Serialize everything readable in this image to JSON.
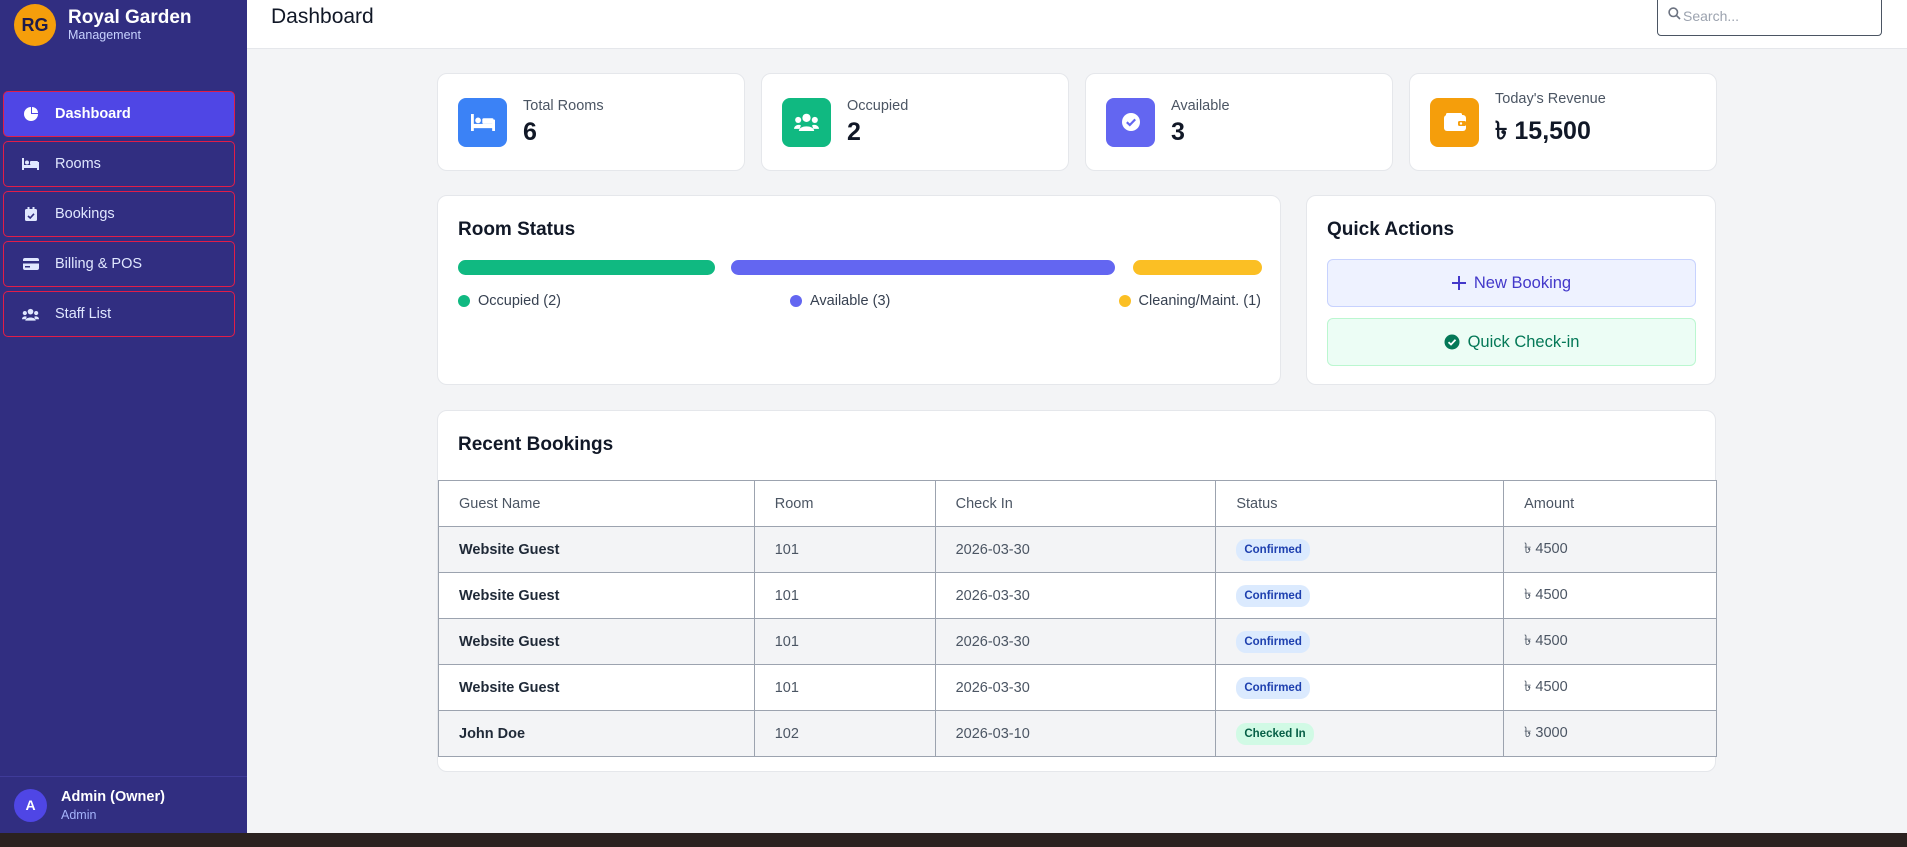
{
  "brand": {
    "logo": "RG",
    "title": "Royal Garden",
    "subtitle": "Management"
  },
  "sidebar": {
    "items": [
      {
        "label": "Dashboard",
        "icon": "pie-chart-icon",
        "active": true
      },
      {
        "label": "Rooms",
        "icon": "bed-icon"
      },
      {
        "label": "Bookings",
        "icon": "calendar-check-icon"
      },
      {
        "label": "Billing & POS",
        "icon": "credit-card-icon"
      },
      {
        "label": "Staff List",
        "icon": "users-icon"
      }
    ]
  },
  "user": {
    "initial": "A",
    "name": "Admin (Owner)",
    "role": "Admin"
  },
  "header": {
    "title": "Dashboard",
    "search_placeholder": "Search..."
  },
  "stats": [
    {
      "label": "Total Rooms",
      "value": "6",
      "color": "#3b82f6",
      "icon": "bed-icon"
    },
    {
      "label": "Occupied",
      "value": "2",
      "color": "#10b981",
      "icon": "users-icon"
    },
    {
      "label": "Available",
      "value": "3",
      "color": "#6366f1",
      "icon": "check-circle-icon"
    },
    {
      "label": "Today's Revenue",
      "value": "৳ 15,500",
      "color": "#f59e0b",
      "icon": "wallet-icon"
    }
  ],
  "room_status": {
    "title": "Room Status",
    "segments": [
      {
        "label": "Occupied (2)",
        "count": 2,
        "color": "#10b981"
      },
      {
        "label": "Available (3)",
        "count": 3,
        "color": "#6366f1"
      },
      {
        "label": "Cleaning/Maint. (1)",
        "count": 1,
        "color": "#fbbf24"
      }
    ]
  },
  "quick_actions": {
    "title": "Quick Actions",
    "new_booking": "New Booking",
    "quick_checkin": "Quick Check-in"
  },
  "recent_bookings": {
    "title": "Recent Bookings",
    "columns": [
      "Guest Name",
      "Room",
      "Check In",
      "Status",
      "Amount"
    ],
    "rows": [
      {
        "guest": "Website Guest",
        "room": "101",
        "check_in": "2026-03-30",
        "status": "Confirmed",
        "amount": "৳ 4500"
      },
      {
        "guest": "Website Guest",
        "room": "101",
        "check_in": "2026-03-30",
        "status": "Confirmed",
        "amount": "৳ 4500"
      },
      {
        "guest": "Website Guest",
        "room": "101",
        "check_in": "2026-03-30",
        "status": "Confirmed",
        "amount": "৳ 4500"
      },
      {
        "guest": "Website Guest",
        "room": "101",
        "check_in": "2026-03-30",
        "status": "Confirmed",
        "amount": "৳ 4500"
      },
      {
        "guest": "John Doe",
        "room": "102",
        "check_in": "2026-03-10",
        "status": "Checked In",
        "amount": "৳ 3000"
      }
    ]
  },
  "colors": {
    "sidebar": "#312e81",
    "accent": "#4f46e5",
    "nav_border": "#e11d48"
  }
}
